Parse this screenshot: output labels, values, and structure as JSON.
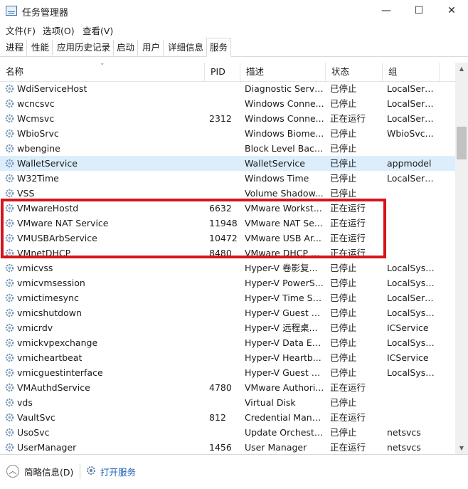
{
  "window": {
    "title": "任务管理器",
    "minimize": "—",
    "maximize": "☐",
    "close": "✕"
  },
  "menu": [
    "文件(F)",
    "选项(O)",
    "查看(V)"
  ],
  "tabs": [
    "进程",
    "性能",
    "应用历史记录",
    "启动",
    "用户",
    "详细信息",
    "服务"
  ],
  "active_tab": "服务",
  "columns": [
    "名称",
    "PID",
    "描述",
    "状态",
    "组"
  ],
  "rows": [
    {
      "name": "WdiServiceHost",
      "pid": "",
      "desc": "Diagnostic Servi...",
      "status": "已停止",
      "group": "LocalServ..."
    },
    {
      "name": "wcncsvc",
      "pid": "",
      "desc": "Windows Conne...",
      "status": "已停止",
      "group": "LocalServ..."
    },
    {
      "name": "Wcmsvc",
      "pid": "2312",
      "desc": "Windows Conne...",
      "status": "正在运行",
      "group": "LocalServ..."
    },
    {
      "name": "WbioSrvc",
      "pid": "",
      "desc": "Windows Biome...",
      "status": "已停止",
      "group": "WbioSvc..."
    },
    {
      "name": "wbengine",
      "pid": "",
      "desc": "Block Level Back...",
      "status": "已停止",
      "group": ""
    },
    {
      "name": "WalletService",
      "pid": "",
      "desc": "WalletService",
      "status": "已停止",
      "group": "appmodel",
      "selected": true
    },
    {
      "name": "W32Time",
      "pid": "",
      "desc": "Windows Time",
      "status": "已停止",
      "group": "LocalServ..."
    },
    {
      "name": "VSS",
      "pid": "",
      "desc": "Volume Shadow...",
      "status": "已停止",
      "group": ""
    },
    {
      "name": "VMwareHostd",
      "pid": "6632",
      "desc": "VMware Workst...",
      "status": "正在运行",
      "group": ""
    },
    {
      "name": "VMware NAT Service",
      "pid": "11948",
      "desc": "VMware NAT Se...",
      "status": "正在运行",
      "group": ""
    },
    {
      "name": "VMUSBArbService",
      "pid": "10472",
      "desc": "VMware USB Ar...",
      "status": "正在运行",
      "group": ""
    },
    {
      "name": "VMnetDHCP",
      "pid": "8480",
      "desc": "VMware DHCP S...",
      "status": "正在运行",
      "group": ""
    },
    {
      "name": "vmicvss",
      "pid": "",
      "desc": "Hyper-V 卷影复...",
      "status": "已停止",
      "group": "LocalSyst..."
    },
    {
      "name": "vmicvmsession",
      "pid": "",
      "desc": "Hyper-V PowerS...",
      "status": "已停止",
      "group": "LocalSyst..."
    },
    {
      "name": "vmictimesync",
      "pid": "",
      "desc": "Hyper-V Time Sy...",
      "status": "已停止",
      "group": "LocalServ..."
    },
    {
      "name": "vmicshutdown",
      "pid": "",
      "desc": "Hyper-V Guest S...",
      "status": "已停止",
      "group": "LocalSyst..."
    },
    {
      "name": "vmicrdv",
      "pid": "",
      "desc": "Hyper-V 远程桌...",
      "status": "已停止",
      "group": "ICService"
    },
    {
      "name": "vmickvpexchange",
      "pid": "",
      "desc": "Hyper-V Data Ex...",
      "status": "已停止",
      "group": "LocalSyst..."
    },
    {
      "name": "vmicheartbeat",
      "pid": "",
      "desc": "Hyper-V Heartb...",
      "status": "已停止",
      "group": "ICService"
    },
    {
      "name": "vmicguestinterface",
      "pid": "",
      "desc": "Hyper-V Guest S...",
      "status": "已停止",
      "group": "LocalSyst..."
    },
    {
      "name": "VMAuthdService",
      "pid": "4780",
      "desc": "VMware Authori...",
      "status": "正在运行",
      "group": ""
    },
    {
      "name": "vds",
      "pid": "",
      "desc": "Virtual Disk",
      "status": "已停止",
      "group": ""
    },
    {
      "name": "VaultSvc",
      "pid": "812",
      "desc": "Credential Mana...",
      "status": "正在运行",
      "group": ""
    },
    {
      "name": "UsoSvc",
      "pid": "",
      "desc": "Update Orchestr...",
      "status": "已停止",
      "group": "netsvcs"
    },
    {
      "name": "UserManager",
      "pid": "1456",
      "desc": "User Manager",
      "status": "正在运行",
      "group": "netsvcs"
    }
  ],
  "footer": {
    "fewer_details": "简略信息(D)",
    "open_services": "打开服务"
  },
  "colors": {
    "highlight_box": "#d7141a",
    "selected_row": "#dceefb",
    "link": "#1a5fb4"
  }
}
